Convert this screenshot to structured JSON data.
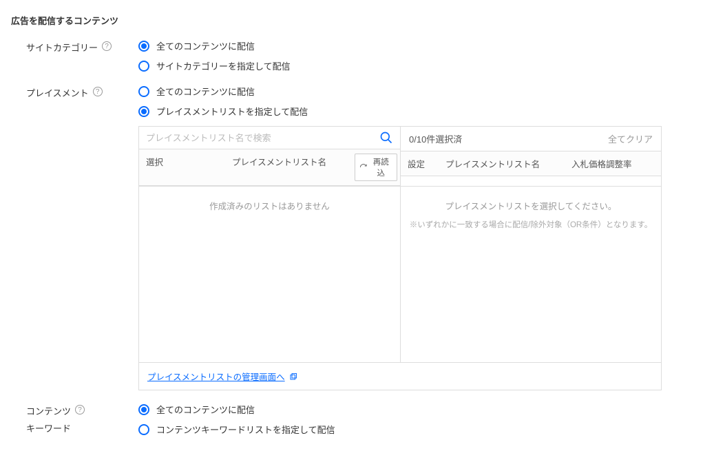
{
  "section_title": "広告を配信するコンテンツ",
  "site_category": {
    "label": "サイトカテゴリー",
    "opt_all": "全てのコンテンツに配信",
    "opt_specify": "サイトカテゴリーを指定して配信"
  },
  "placement": {
    "label": "プレイスメント",
    "opt_all": "全てのコンテンツに配信",
    "opt_specify": "プレイスメントリストを指定して配信",
    "search_placeholder": "プレイスメントリスト名で検索",
    "selected_count": "0/10件選択済",
    "clear_all": "全てクリア",
    "left_hdr_select": "選択",
    "left_hdr_name": "プレイスメントリスト名",
    "reload": "再読込",
    "right_hdr_set": "設定",
    "right_hdr_name": "プレイスメントリスト名",
    "right_hdr_bid": "入札価格調整率",
    "left_empty": "作成済みのリストはありません",
    "right_empty": "プレイスメントリストを選択してください。",
    "right_note": "※いずれかに一致する場合に配信/除外対象（OR条件）となります。",
    "mgmt_link": "プレイスメントリストの管理画面へ"
  },
  "content_keyword": {
    "label1": "コンテンツ",
    "label2": "キーワード",
    "opt_all": "全てのコンテンツに配信",
    "opt_specify": "コンテンツキーワードリストを指定して配信"
  }
}
